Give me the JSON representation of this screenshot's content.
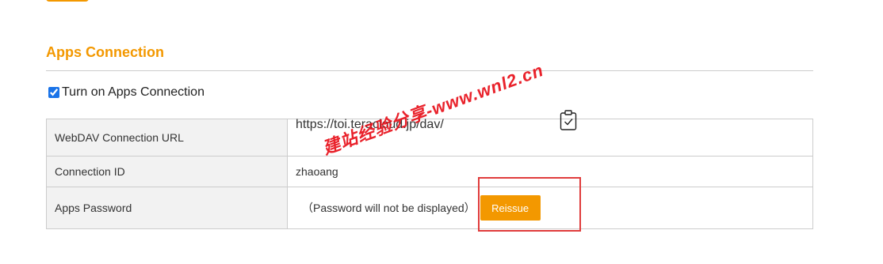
{
  "section": {
    "title": "Apps Connection",
    "toggle_label": "Turn on Apps Connection",
    "toggle_checked": true
  },
  "table": {
    "rows": [
      {
        "label": "WebDAV Connection URL",
        "value": "https://toi.teracloud.jp/dav/"
      },
      {
        "label": "Connection ID",
        "value": "zhaoang"
      },
      {
        "label": "Apps Password",
        "value": "（Password will not be displayed）"
      }
    ],
    "copy_icon": "clipboard-check-icon",
    "reissue_label": "Reissue"
  },
  "watermark": "建站经验分享-www.wnl2.cn",
  "colors": {
    "accent": "#f39800",
    "highlight": "#e03c3c",
    "label_bg": "#f2f2f2",
    "border": "#cccccc"
  }
}
